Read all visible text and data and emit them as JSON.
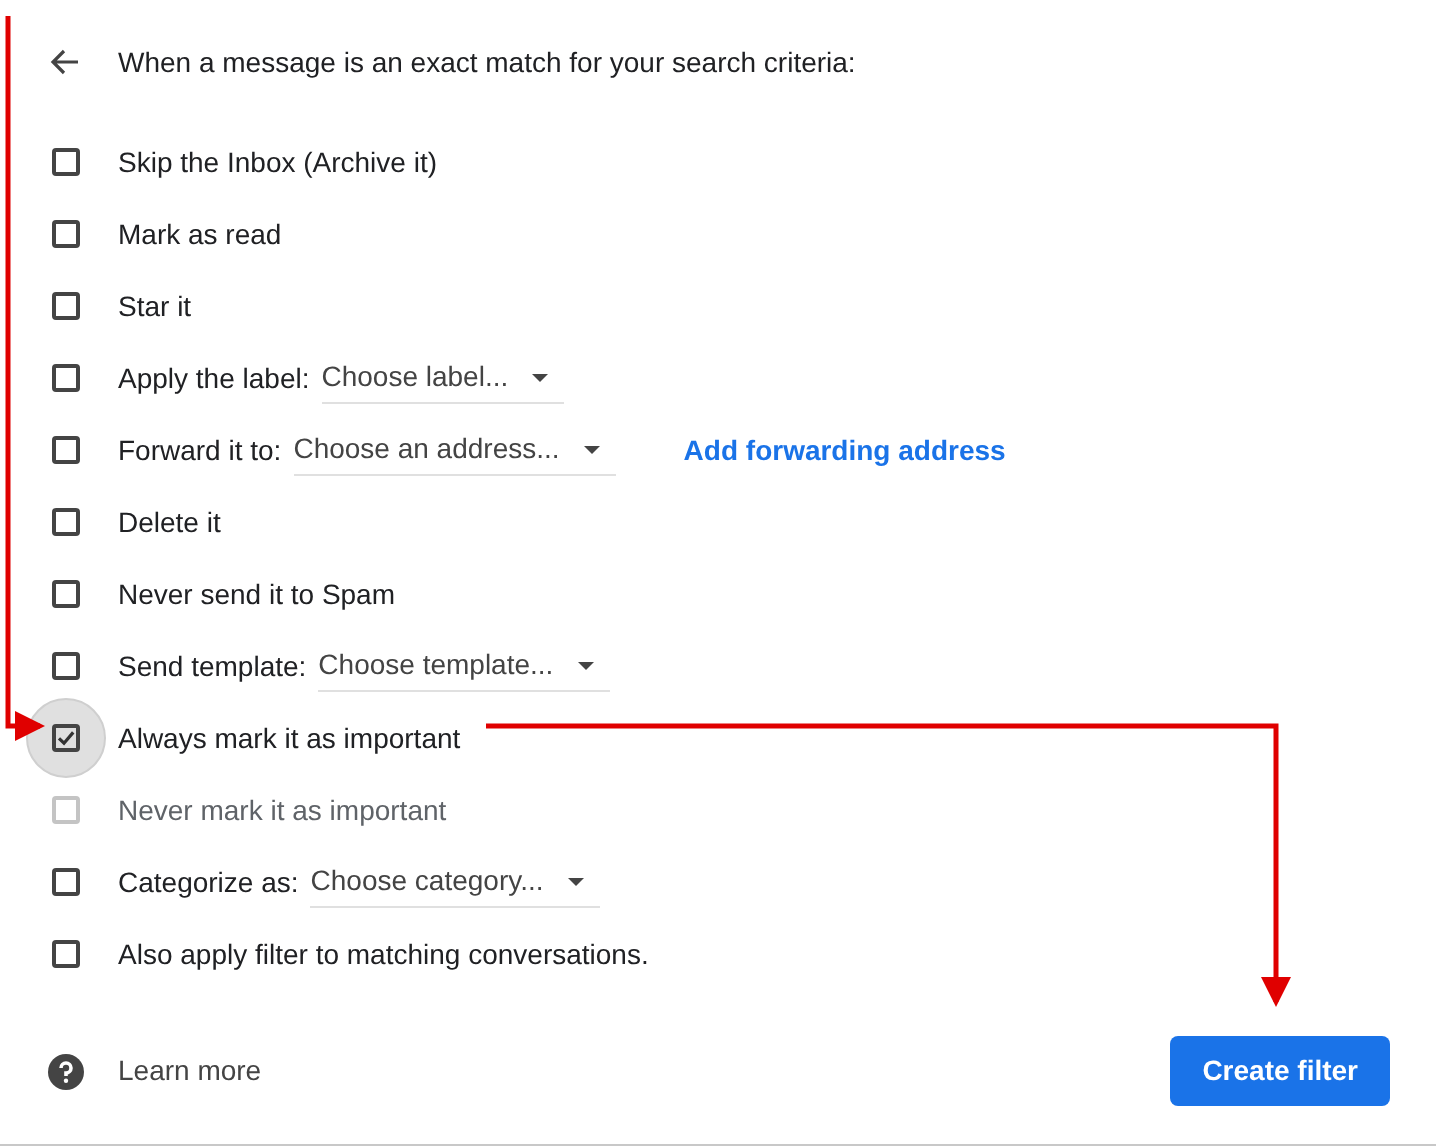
{
  "header": {
    "title": "When a message is an exact match for your search criteria:"
  },
  "actions": [
    {
      "kind": "plain",
      "label": "Skip the Inbox (Archive it)",
      "checked": false,
      "disabled": false,
      "focused": false
    },
    {
      "kind": "plain",
      "label": "Mark as read",
      "checked": false,
      "disabled": false,
      "focused": false
    },
    {
      "kind": "plain",
      "label": "Star it",
      "checked": false,
      "disabled": false,
      "focused": false
    },
    {
      "kind": "select",
      "label": "Apply the label:",
      "value": "Choose label...",
      "checked": false,
      "disabled": false,
      "focused": false
    },
    {
      "kind": "select",
      "label": "Forward it to:",
      "value": "Choose an address...",
      "link": "Add forwarding address",
      "checked": false,
      "disabled": false,
      "focused": false
    },
    {
      "kind": "plain",
      "label": "Delete it",
      "checked": false,
      "disabled": false,
      "focused": false
    },
    {
      "kind": "plain",
      "label": "Never send it to Spam",
      "checked": false,
      "disabled": false,
      "focused": false
    },
    {
      "kind": "select",
      "label": "Send template:",
      "value": "Choose template...",
      "checked": false,
      "disabled": false,
      "focused": false
    },
    {
      "kind": "plain",
      "label": "Always mark it as important",
      "checked": true,
      "disabled": false,
      "focused": true
    },
    {
      "kind": "plain",
      "label": "Never mark it as important",
      "checked": false,
      "disabled": true,
      "focused": false
    },
    {
      "kind": "select",
      "label": "Categorize as:",
      "value": "Choose category...",
      "checked": false,
      "disabled": false,
      "focused": false
    },
    {
      "kind": "plain",
      "label": "Also apply filter to matching conversations.",
      "checked": false,
      "disabled": false,
      "focused": false
    }
  ],
  "footer": {
    "help_link": "Learn more",
    "button": "Create filter"
  }
}
